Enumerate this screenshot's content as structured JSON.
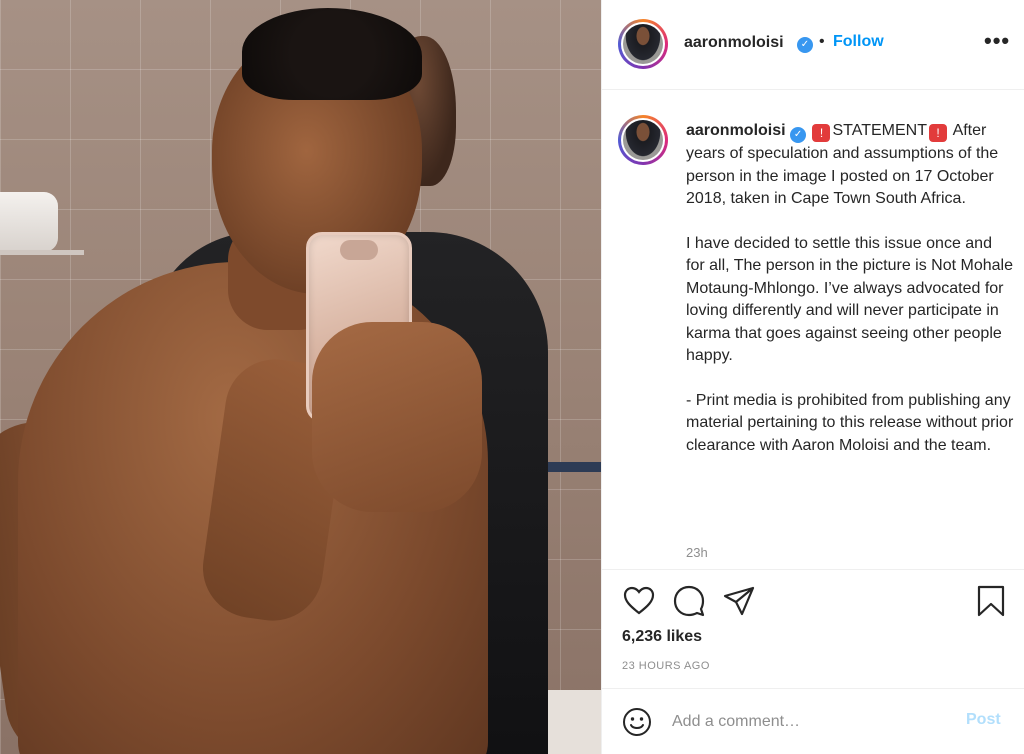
{
  "post": {
    "username": "aaronmoloisi",
    "follow_label": "Follow",
    "dot": "•",
    "more": "•••",
    "verified_icon": "verified-check-icon"
  },
  "caption": {
    "username": "aaronmoloisi",
    "statement_label": "STATEMENT",
    "intro": "After years of speculation and assumptions of the person in the image I posted on 17 October 2018, taken in Cape Town South Africa.",
    "para1": "I have decided to settle this issue once and for all, The person in the picture is Not Mohale Motaung-Mhlongo. I’ve always advocated for loving differently and will never participate in karma that goes against seeing other people happy.",
    "para2": "- Print media is prohibited from publishing any material pertaining to this release without prior clearance with Aaron Moloisi and the team.",
    "time": "23h"
  },
  "stats": {
    "likes": "6,236 likes",
    "posted_ago": "23 HOURS AGO"
  },
  "comment": {
    "placeholder": "Add a comment…",
    "post_label": "Post"
  },
  "colors": {
    "link_blue": "#0095f6",
    "post_disabled": "#b2dffc",
    "verified": "#3897f0",
    "muted": "#8e8e8e",
    "siren": "#e23b3b"
  }
}
